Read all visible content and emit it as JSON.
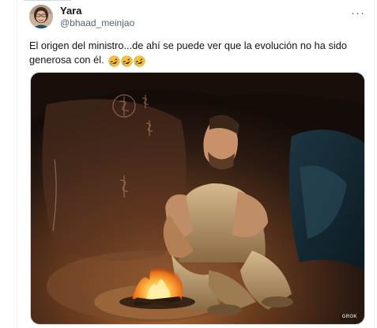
{
  "tweet": {
    "author": {
      "display_name": "Yara",
      "handle": "@bhaad_meinjao",
      "avatar_icon": "user-avatar"
    },
    "more_icon": "more-horizontal-icon",
    "text": "El origen del ministro...de ahí se puede ver que la evolución no ha sido generosa con él.",
    "emojis": [
      "rolling-on-floor-laughing",
      "rolling-on-floor-laughing",
      "rolling-on-floor-laughing"
    ],
    "media": {
      "badge": "GROK"
    }
  },
  "colors": {
    "text_primary": "#0f1419",
    "text_secondary": "#536471",
    "border": "#cfd9de"
  }
}
